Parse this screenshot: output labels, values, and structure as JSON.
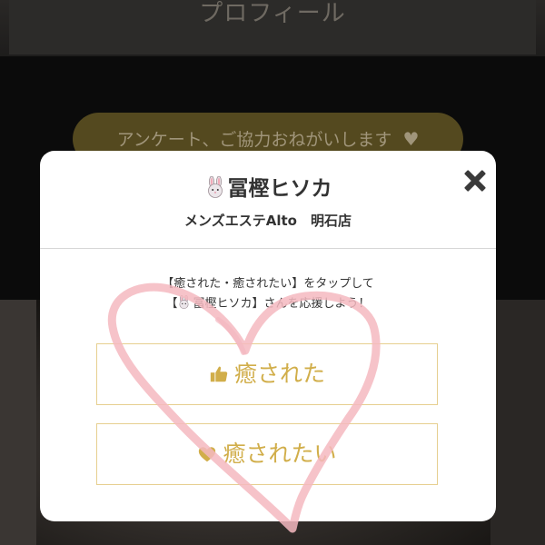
{
  "background": {
    "header_title": "プロフィール",
    "survey_button_label": "アンケート、ご協力おねがいします",
    "survey_icon": "heart-icon"
  },
  "modal": {
    "therapist_icon": "rabbit-emoji",
    "therapist_name": "冨樫ヒソカ",
    "shop_name": "メンズエステAlto　明石店",
    "close_icon": "close-icon",
    "instruction_line1": "【癒された・癒されたい】をタップして",
    "instruction_line2_prefix": "【",
    "instruction_line2_name": "冨樫ヒソカ",
    "instruction_line2_suffix": "】さんを応援しよう！",
    "vote_buttons": [
      {
        "icon": "thumbs-up-icon",
        "label": "癒された"
      },
      {
        "icon": "heart-icon",
        "label": "癒されたい"
      }
    ]
  },
  "colors": {
    "accent_gold": "#d1ae4a",
    "button_border": "#e6cf8f",
    "decorative_heart": "#f4b8c0"
  }
}
